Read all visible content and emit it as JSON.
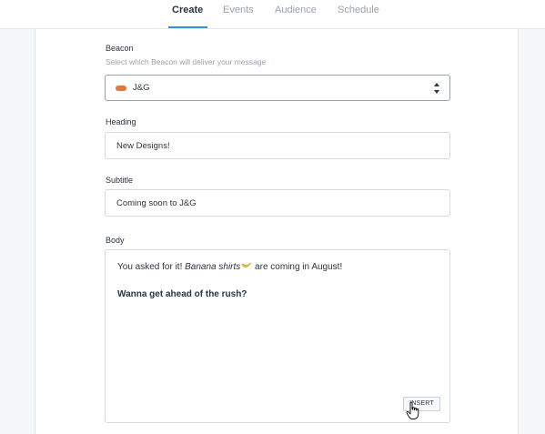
{
  "tabs": [
    {
      "label": "Create",
      "active": true
    },
    {
      "label": "Events",
      "active": false
    },
    {
      "label": "Audience",
      "active": false
    },
    {
      "label": "Schedule",
      "active": false
    }
  ],
  "form": {
    "beacon": {
      "label": "Beacon",
      "hint": "Select which Beacon will deliver your message",
      "value": "J&G",
      "color": "#e0793a"
    },
    "heading": {
      "label": "Heading",
      "value": "New Designs!"
    },
    "subtitle": {
      "label": "Subtitle",
      "value": "Coming soon to J&G"
    },
    "body": {
      "label": "Body",
      "line1_before": "You asked for it! ",
      "line1_italic": "Banana shirts",
      "line1_emoji": "banana-icon",
      "line1_after": " are coming in August!",
      "line2": "Wanna get ahead of the rush?",
      "insert_label": "INSERT"
    }
  },
  "colors": {
    "accent": "#3a8fd8",
    "beacon": "#e0793a"
  }
}
